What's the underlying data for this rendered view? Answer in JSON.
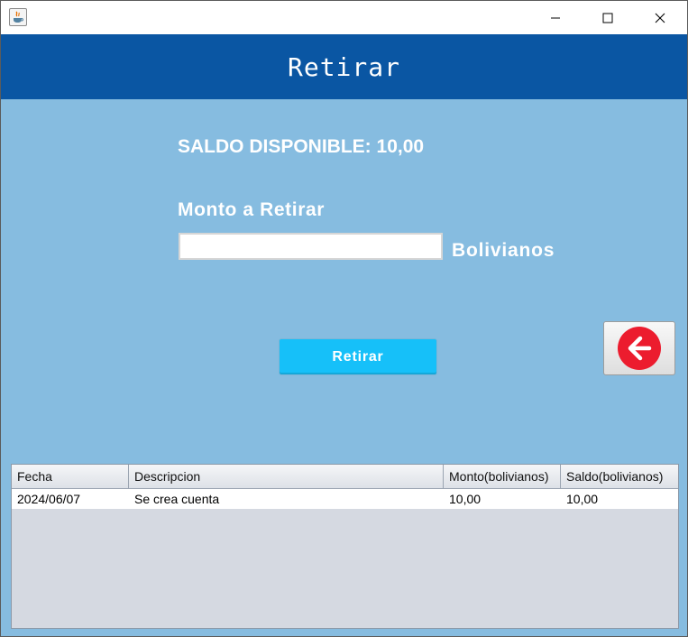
{
  "window": {
    "title": "",
    "controls": [
      "minimize-icon",
      "maximize-icon",
      "close-icon"
    ]
  },
  "header": {
    "title": "Retirar"
  },
  "saldo": {
    "label": "SALDO DISPONIBLE: 10,00"
  },
  "withdraw_form": {
    "amount_label": "Monto a Retirar",
    "amount_value": "",
    "currency_label": "Bolivianos",
    "submit_label": "Retirar"
  },
  "back_button": {
    "icon": "arrow-left-circle-icon"
  },
  "transactions": {
    "columns": [
      "Fecha",
      "Descripcion",
      "Monto(bolivianos)",
      "Saldo(bolivianos)"
    ],
    "rows": [
      {
        "fecha": "2024/06/07",
        "descripcion": "Se crea cuenta",
        "monto": "10,00",
        "saldo": "10,00"
      }
    ]
  },
  "colors": {
    "header_bg": "#0a56a3",
    "body_bg": "#86bce0",
    "button_bg": "#16c0f9",
    "back_icon": "#ec1c2e"
  }
}
